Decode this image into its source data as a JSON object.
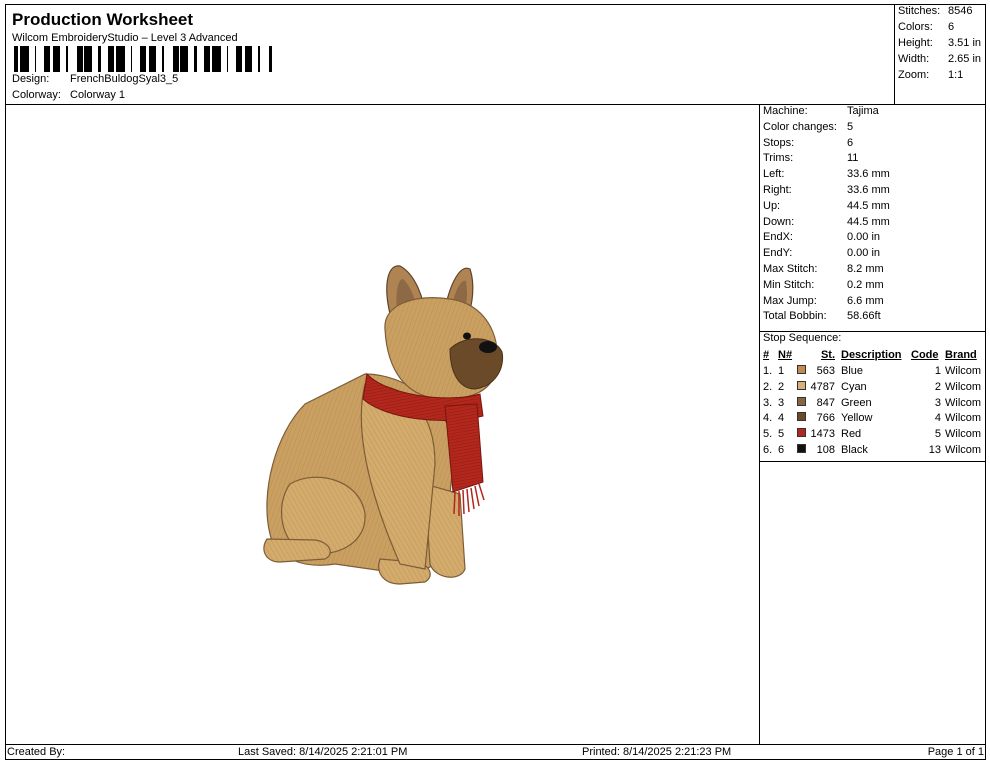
{
  "header": {
    "title": "Production Worksheet",
    "subtitle": "Wilcom EmbroideryStudio – Level 3 Advanced",
    "design_label": "Design:",
    "design_value": "FrenchBuldogSyal3_5",
    "colorway_label": "Colorway:",
    "colorway_value": "Colorway 1"
  },
  "stats": {
    "stitches_label": "Stitches:",
    "stitches": "8546",
    "colors_label": "Colors:",
    "colors": "6",
    "height_label": "Height:",
    "height": "3.51 in",
    "width_label": "Width:",
    "width": "2.65 in",
    "zoom_label": "Zoom:",
    "zoom": "1:1"
  },
  "info": [
    {
      "label": "Machine:",
      "value": "Tajima"
    },
    {
      "label": "Color changes:",
      "value": "5"
    },
    {
      "label": "Stops:",
      "value": "6"
    },
    {
      "label": "Trims:",
      "value": "11"
    },
    {
      "label": "Left:",
      "value": "33.6 mm"
    },
    {
      "label": "Right:",
      "value": "33.6 mm"
    },
    {
      "label": "Up:",
      "value": "44.5 mm"
    },
    {
      "label": "Down:",
      "value": "44.5 mm"
    },
    {
      "label": "EndX:",
      "value": "0.00 in"
    },
    {
      "label": "EndY:",
      "value": "0.00 in"
    },
    {
      "label": "Max Stitch:",
      "value": "8.2 mm"
    },
    {
      "label": "Min Stitch:",
      "value": "0.2 mm"
    },
    {
      "label": "Max Jump:",
      "value": "6.6 mm"
    },
    {
      "label": "Total Bobbin:",
      "value": "58.66ft"
    }
  ],
  "stop_sequence": {
    "title": "Stop Sequence:",
    "columns": {
      "num": "#",
      "n": "N#",
      "st": "St.",
      "desc": "Description",
      "code": "Code",
      "brand": "Brand"
    },
    "rows": [
      {
        "num": "1.",
        "n": "1",
        "color": "#c08a52",
        "st": "563",
        "desc": "Blue",
        "code": "1",
        "brand": "Wilcom"
      },
      {
        "num": "2.",
        "n": "2",
        "color": "#d7b07a",
        "st": "4787",
        "desc": "Cyan",
        "code": "2",
        "brand": "Wilcom"
      },
      {
        "num": "3.",
        "n": "3",
        "color": "#8a6440",
        "st": "847",
        "desc": "Green",
        "code": "3",
        "brand": "Wilcom"
      },
      {
        "num": "4.",
        "n": "4",
        "color": "#6b4a2a",
        "st": "766",
        "desc": "Yellow",
        "code": "4",
        "brand": "Wilcom"
      },
      {
        "num": "5.",
        "n": "5",
        "color": "#b3271d",
        "st": "1473",
        "desc": "Red",
        "code": "5",
        "brand": "Wilcom"
      },
      {
        "num": "6.",
        "n": "6",
        "color": "#111111",
        "st": "108",
        "desc": "Black",
        "code": "13",
        "brand": "Wilcom"
      }
    ]
  },
  "footer": {
    "created_by": "Created By:",
    "last_saved": "Last Saved: 8/14/2025 2:21:01 PM",
    "printed": "Printed: 8/14/2025 2:21:23 PM",
    "page": "Page 1 of 1"
  },
  "colors": {
    "fur": "#c9a062",
    "fur_light": "#dbb77c",
    "ear": "#8d6a45",
    "muzzle": "#6b4a2a",
    "scarf": "#b3271d",
    "nose": "#111111"
  }
}
